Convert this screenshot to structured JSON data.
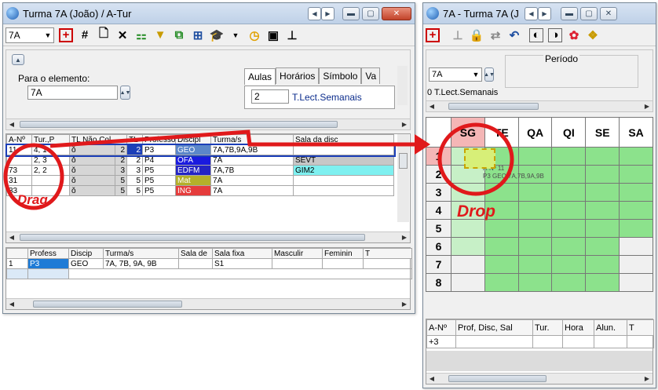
{
  "left_window": {
    "title": "Turma 7A (João) / A-Tur",
    "class_select": "7A",
    "detail": {
      "label": "Para o elemento:",
      "value": "7A",
      "tabs": [
        "Aulas",
        "Horários",
        "Símbolo",
        "Va"
      ],
      "count_value": "2",
      "count_label": "T.Lect.Semanais"
    },
    "lessons_table": {
      "headers": [
        "A-Nº",
        "Tur.,P",
        "TL Não Col.",
        "TL",
        "Professo",
        "Discipl",
        "Turma/s",
        "Sala da disc"
      ],
      "rows": [
        [
          "11",
          "4, 1",
          "ǒ",
          "2",
          "2",
          "P3",
          "GEO",
          "7A,7B,9A,9B",
          ""
        ],
        [
          "7",
          "2, 3",
          "ǒ",
          "2",
          "2",
          "P4",
          "OFA",
          "7A",
          "SEVT"
        ],
        [
          "73",
          "2, 2",
          "ǒ",
          "3",
          "3",
          "P5",
          "EDFM",
          "7A,7B",
          "GIM2"
        ],
        [
          "31",
          "",
          "ǒ",
          "5",
          "5",
          "P5",
          "Mat",
          "7A",
          ""
        ],
        [
          "33",
          "",
          "ǒ",
          "5",
          "5",
          "P5",
          "ING",
          "7A",
          ""
        ]
      ],
      "subject_colors": {
        "GEO": "#5b87c9",
        "OFA": "#1a1adf",
        "EDFM": "#2424c4",
        "Mat": "#b4b02a",
        "ING": "#e53c3c"
      }
    },
    "bottom_table": {
      "headers": [
        "",
        "Profess",
        "Discip",
        "Turma/s",
        "Sala de",
        "Sala fixa",
        "Masculir",
        "Feminin",
        "T"
      ],
      "rows": [
        [
          "1",
          "P3",
          "GEO",
          "7A, 7B, 9A, 9B",
          "",
          "S1",
          "",
          "",
          ""
        ]
      ]
    }
  },
  "right_window": {
    "title": "7A - Turma 7A (J",
    "class_select": "7A",
    "period_label": "Período",
    "count_text": "0 T.Lect.Semanais",
    "days": [
      "SG",
      "TE",
      "QA",
      "QI",
      "SE",
      "SA"
    ],
    "periods": [
      "1",
      "2",
      "3",
      "4",
      "5",
      "6",
      "7",
      "8"
    ],
    "ghost_lesson": {
      "line1": "A-Nº 11",
      "line2": "P3  GEO  7A,7B,9A,9B"
    },
    "unscheduled": {
      "headers": [
        "A-Nº",
        "Prof, Disc, Sal",
        "Tur.",
        "Hora",
        "Alun.",
        "T"
      ],
      "rows": [
        [
          "+3",
          "",
          "",
          "",
          "",
          ""
        ]
      ]
    }
  },
  "annotations": {
    "drag": "Drag",
    "drop": "Drop",
    "color": "#e0191b"
  }
}
